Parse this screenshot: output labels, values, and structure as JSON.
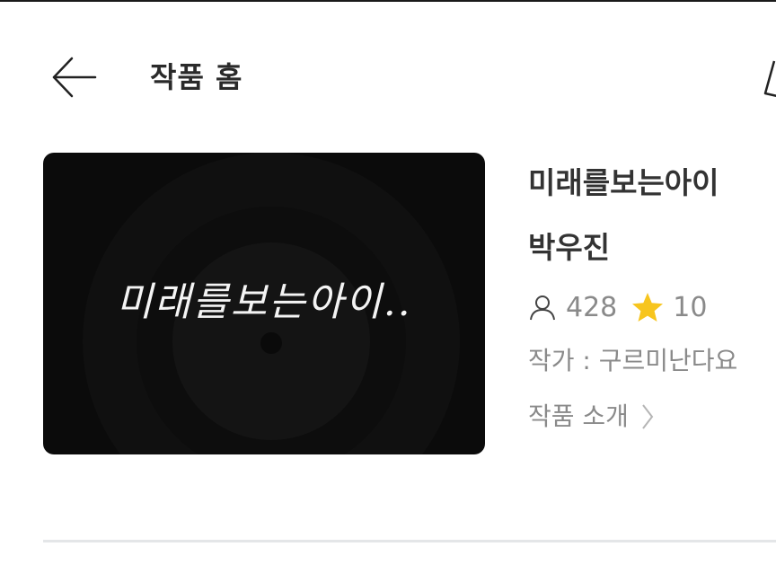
{
  "header": {
    "title": "작품 홈",
    "back_icon": "arrow-left-icon",
    "share_icon": "share-icon"
  },
  "cover": {
    "title": "미래를보는아이.."
  },
  "work": {
    "title": "미래를보는아이",
    "subtitle": "박우진",
    "views": "428",
    "stars": "10",
    "author": "작가 : 구르미난다요",
    "intro_label": "작품 소개"
  },
  "colors": {
    "text_dark": "#333333",
    "text_gray": "#8a8a8a",
    "star": "#f7c51e",
    "cover_bg": "#0b0b0b",
    "divider": "#e4e6e8"
  }
}
